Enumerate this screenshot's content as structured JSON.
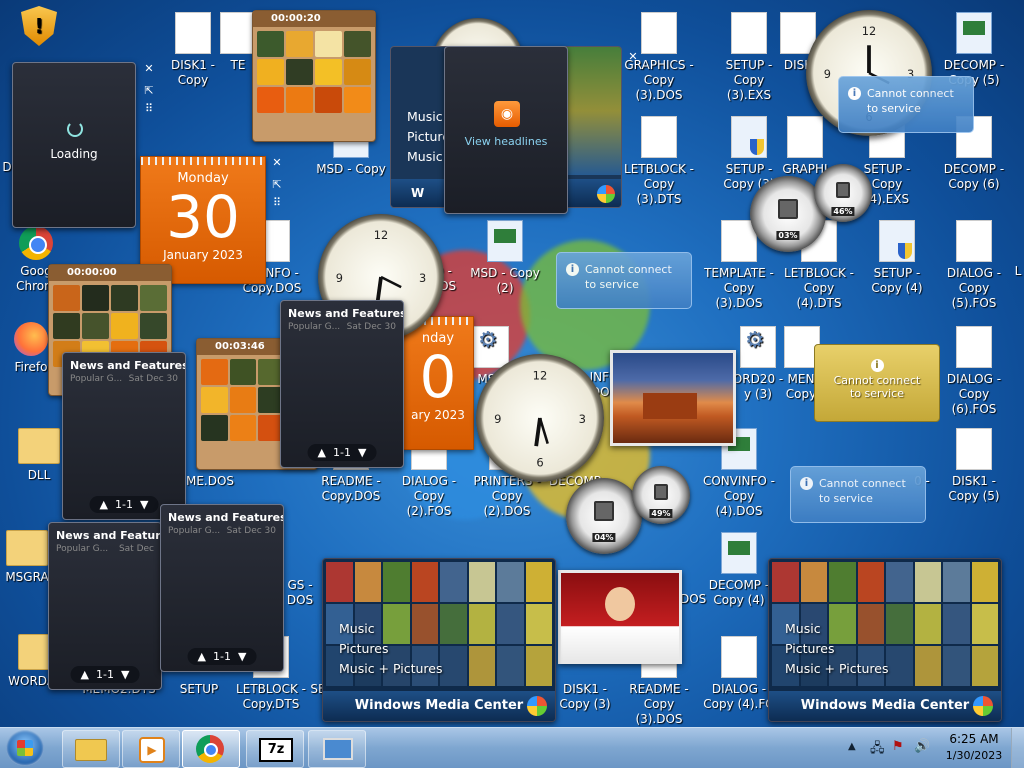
{
  "colors": {
    "desktop": "#1f6fc0",
    "calendar": "#e96b0c",
    "taskbar": "#8fb2db"
  },
  "desktop_icons": [
    {
      "label": "DISK1 - Copy",
      "type": "file"
    },
    {
      "label": "TE",
      "type": "file"
    },
    {
      "label": "GRAPHICS - Copy (3).DOS",
      "type": "file"
    },
    {
      "label": "SETUP - Copy (3).EXS",
      "type": "file"
    },
    {
      "label": "DISK",
      "type": "file"
    },
    {
      "label": "DECOMP - Copy (5)",
      "type": "app"
    },
    {
      "label": "D",
      "type": "file"
    },
    {
      "label": "MSD - Copy",
      "type": "app"
    },
    {
      "label": "LETBLOCK - Copy (3).DTS",
      "type": "file"
    },
    {
      "label": "SETUP - Copy (3)",
      "type": "shield"
    },
    {
      "label": "GRAPHI",
      "type": "file"
    },
    {
      "label": "SETUP - Copy (4).EXS",
      "type": "file"
    },
    {
      "label": "DECOMP - Copy (6)",
      "type": "file"
    },
    {
      "label": "Goog Chrom",
      "type": "chrome"
    },
    {
      "label": "CVINFO - Copy.DOS",
      "type": "file"
    },
    {
      "label": "O - DOS",
      "type": "file"
    },
    {
      "label": "MSD - Copy (2)",
      "type": "app"
    },
    {
      "label": "TEMPLATE - Copy (3).DOS",
      "type": "file"
    },
    {
      "label": "LETBLOCK - Copy (4).DTS",
      "type": "file"
    },
    {
      "label": "SETUP - Copy (4)",
      "type": "shield"
    },
    {
      "label": "DIALOG - Copy (5).FOS",
      "type": "file"
    },
    {
      "label": "L",
      "type": "file"
    },
    {
      "label": "Firefo",
      "type": "firefox"
    },
    {
      "label": "MSD",
      "type": "gear"
    },
    {
      "label": "INFO DOS",
      "type": "file"
    },
    {
      "label": "ORD20 - y (3)",
      "type": "file"
    },
    {
      "label": "MEN Copy",
      "type": "file"
    },
    {
      "label": "DIALOG - Copy (6).FOS",
      "type": "file"
    },
    {
      "label": "DLL",
      "type": "folder"
    },
    {
      "label": "ME.DOS",
      "type": "file"
    },
    {
      "label": "README - Copy.DOS",
      "type": "file"
    },
    {
      "label": "DIALOG - Copy (2).FOS",
      "type": "file"
    },
    {
      "label": "PRINTERS - Copy (2).DOS",
      "type": "file"
    },
    {
      "label": "DECOMP",
      "type": "file"
    },
    {
      "label": "CONVINFO - Copy (4).DOS",
      "type": "app"
    },
    {
      "label": "0 -",
      "type": "file"
    },
    {
      "label": "DISK1 - Copy (5)",
      "type": "file"
    },
    {
      "label": "MSGRA",
      "type": "folder"
    },
    {
      "label": "GS - DOS",
      "type": "file"
    },
    {
      "label": "DOS",
      "type": "file"
    },
    {
      "label": "DECOMP - Copy (4)",
      "type": "app"
    },
    {
      "label": "WORDART",
      "type": "folder"
    },
    {
      "label": "MEMO2.DTS",
      "type": "file"
    },
    {
      "label": "SETUP",
      "type": "file"
    },
    {
      "label": "LETBLOCK - Copy.DTS",
      "type": "file"
    },
    {
      "label": "SETU",
      "type": "file"
    },
    {
      "label": "DISK1 - Copy (3)",
      "type": "file"
    },
    {
      "label": "README - Copy (3).DOS",
      "type": "file"
    },
    {
      "label": "DIALOG - Copy (4).FO",
      "type": "file"
    }
  ],
  "gadgets": {
    "loading": {
      "text": "Loading"
    },
    "calendar": [
      {
        "day": "Monday",
        "date": "30",
        "month": "January 2023"
      },
      {
        "day": "nday",
        "date": "0",
        "month": "ary 2023"
      }
    ],
    "puzzle": [
      {
        "time": "00:00:00"
      },
      {
        "time": "00:00:00"
      },
      {
        "time": "00:03:46"
      },
      {
        "time": "00:00:20"
      }
    ],
    "rss": {
      "link": "View headlines"
    },
    "news": [
      {
        "title": "News and Features f...",
        "source": "Popular G...",
        "date": "Sat Dec 30",
        "pager": "1-1"
      },
      {
        "title": "News and Features f...",
        "source": "Popular G...",
        "date": "Sat Dec 30",
        "pager": "1-1"
      },
      {
        "title": "News and Features f",
        "source": "Popular G...",
        "date": "Sat Dec",
        "pager": "1-1"
      },
      {
        "title": "News and Features f...",
        "source": "Popular G...",
        "date": "Sat Dec 30",
        "pager": "1-1"
      }
    ],
    "cannot_connect": "Cannot connect to service",
    "meters": [
      {
        "cpu": "03%",
        "mem": "46%"
      },
      {
        "cpu": "04%",
        "mem": "49%"
      }
    ],
    "wmc": {
      "menu": [
        "Music",
        "Pictures",
        "Music + Pictures"
      ],
      "brand": "Windows Media Center"
    },
    "wmc_small": {
      "menu": [
        "Music",
        "Picture",
        "Music"
      ],
      "brand": "W"
    }
  },
  "taskbar": {
    "time": "6:25 AM",
    "date": "1/30/2023",
    "apps": [
      "Windows Explorer",
      "Windows Media Player",
      "Google Chrome",
      "7-Zip",
      "Remote Desktop"
    ],
    "sevenzip": "7z"
  }
}
